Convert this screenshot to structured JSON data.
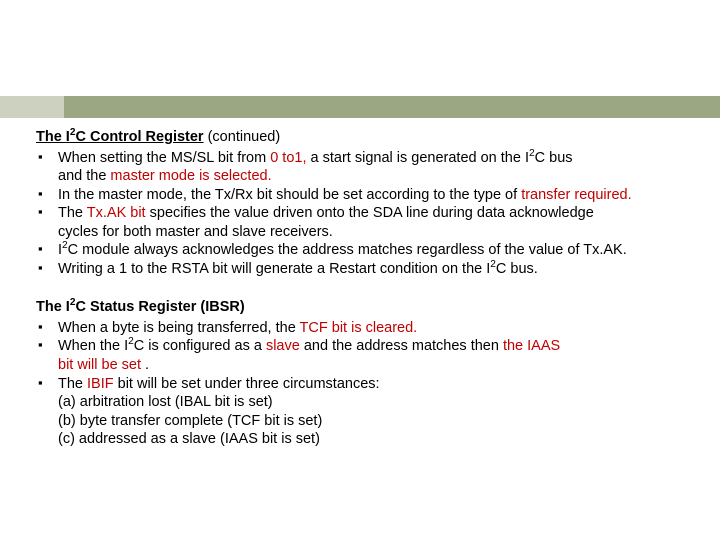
{
  "s1": {
    "sup": "2",
    "t1": "The I",
    "t2": "C Control Register",
    "trail": " (continued)",
    "b1": {
      "a": "When setting the MS/SL bit from ",
      "b": "0 to1, ",
      "c": "a start signal is generated on the I",
      "d": "C bus",
      "e": "and the ",
      "f": "master mode is selected."
    },
    "b2": {
      "a": "In the master mode, the Tx/Rx bit should be set according to the type of ",
      "b": "transfer required."
    },
    "b3": {
      "a": "The ",
      "b": "Tx.AK bit ",
      "c": "specifies the value driven onto the SDA line during data acknowledge",
      "d": "cycles for both master and slave receivers."
    },
    "b4": {
      "a": "I",
      "b": "C module always acknowledges the address matches regardless of the value of Tx.AK."
    },
    "b5": {
      "a": "Writing a 1 to the RSTA bit will generate a Restart condition on the I",
      "b": "C bus."
    }
  },
  "s2": {
    "sup": "2",
    "t1": "The I",
    "t2": "C Status Register (IBSR)",
    "b1": {
      "a": "When a byte is being transferred, the ",
      "b": "TCF bit is cleared."
    },
    "b2": {
      "a": "When the I",
      "b": "C is configured as a ",
      "c": "slave ",
      "d": "and the address matches then ",
      "e": "the IAAS",
      "f": "bit will be set ",
      "g": "."
    },
    "b3": {
      "a": "The ",
      "b": "IBIF ",
      "c": "bit will be set under three circumstances:",
      "d": "(a) arbitration lost (IBAL bit is set)",
      "e": "(b) byte transfer complete (TCF bit is set)",
      "f": "(c) addressed as a slave (IAAS bit is set)"
    }
  }
}
